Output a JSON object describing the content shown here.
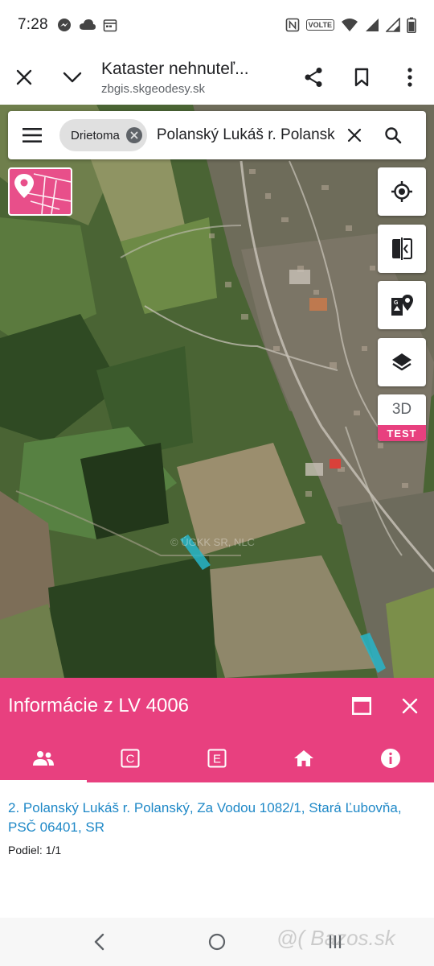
{
  "status_bar": {
    "time": "7:28",
    "volte": "VOLTE"
  },
  "browser": {
    "title": "Kataster nehnuteľ...",
    "url": "zbgis.skgeodesy.sk"
  },
  "search": {
    "chip_label": "Drietoma",
    "query": "Polanský Lukáš r. Polansk"
  },
  "map": {
    "three_d_label": "3D",
    "test_label": "TEST",
    "watermark": "© ÚGKK SR, NLC"
  },
  "panel": {
    "title": "Informácie z LV 4006",
    "tabs": [
      {
        "icon": "people-icon",
        "active": true
      },
      {
        "icon": "c-icon",
        "glyph": "C"
      },
      {
        "icon": "e-icon",
        "glyph": "E"
      },
      {
        "icon": "home-icon"
      },
      {
        "icon": "info-icon"
      }
    ],
    "owner": "2. Polanský Lukáš r. Polanský, Za Vodou 1082/1, Stará Ľubovňa, PSČ 06401, SR",
    "share": "Podiel: 1/1"
  },
  "overlay": {
    "bazos": "@( Bazos.sk"
  },
  "colors": {
    "accent": "#e8407f",
    "link": "#1e88c7"
  }
}
